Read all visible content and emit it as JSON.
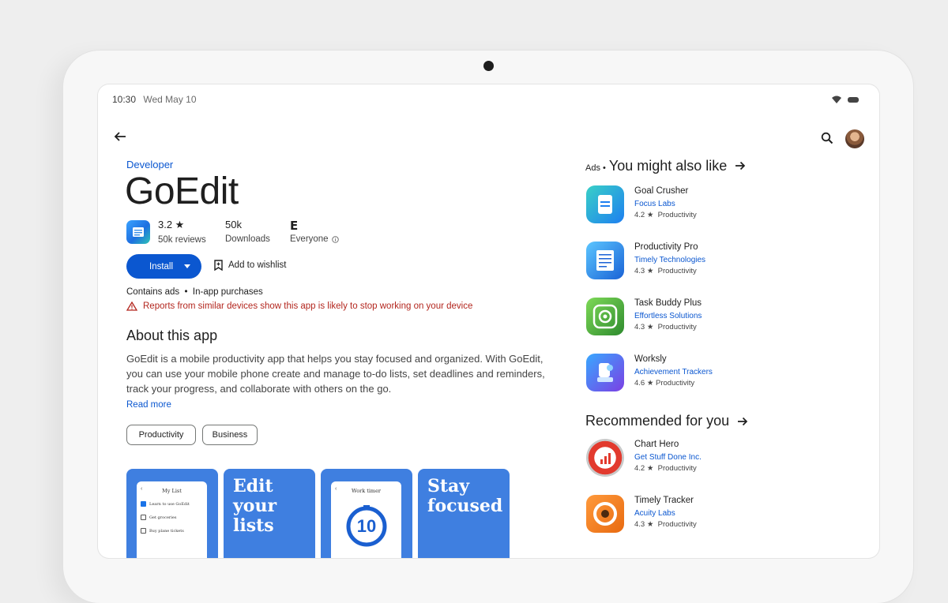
{
  "status": {
    "time": "10:30",
    "date": "Wed May 10"
  },
  "app": {
    "developer": "Developer",
    "title": "GoEdit",
    "rating": "3.2 ★",
    "reviews": "50k reviews",
    "downloads_value": "50k",
    "downloads_label": "Downloads",
    "content_rating_badge": "E",
    "content_rating_label": "Everyone",
    "install_label": "Install",
    "wishlist_label": "Add to wishlist",
    "meta": "Contains ads  •  In-app purchases",
    "warning": "Reports from similar devices show this app is likely to stop working on your device"
  },
  "about": {
    "title": "About this app",
    "text": "GoEdit is a mobile productivity app that helps you stay focused and organized. With GoEdit, you can use your mobile phone create and manage to-do lists, set deadlines and reminders, track your progress, and collaborate with others on the go.",
    "read_more": "Read more"
  },
  "chips": [
    "Productivity",
    "Business"
  ],
  "screenshots": {
    "shot1": {
      "list_title": "My List",
      "items": [
        "Learn to use GoEdit",
        "Get groceries",
        "Buy plane tickets"
      ]
    },
    "shot2_text": "Edit your lists",
    "shot3": {
      "title": "Work timer",
      "value": "10"
    },
    "shot4_text": "Stay focused"
  },
  "ads_section": {
    "ads_label": "Ads •",
    "title": "You might also like",
    "items": [
      {
        "name": "Goal Crusher",
        "developer": "Focus Labs",
        "meta": "4.2 ★  Productivity"
      },
      {
        "name": "Productivity Pro",
        "developer": "Timely Technologies",
        "meta": "4.3 ★  Productivity"
      },
      {
        "name": "Task Buddy Plus",
        "developer": "Effortless Solutions",
        "meta": "4.3 ★  Productivity"
      },
      {
        "name": "Worksly",
        "developer": "Achievement Trackers",
        "meta": "4.6 ★ Productivity"
      }
    ]
  },
  "recommended": {
    "title": "Recommended for you",
    "items": [
      {
        "name": "Chart Hero",
        "developer": "Get Stuff Done Inc.",
        "meta": "4.2 ★  Productivity"
      },
      {
        "name": "Timely Tracker",
        "developer": "Acuity Labs",
        "meta": "4.3 ★  Productivity"
      }
    ]
  },
  "icons": {
    "back": "back-arrow-icon",
    "search": "search-icon",
    "wifi": "wifi-icon",
    "battery": "battery-icon",
    "bookmark": "bookmark-add-icon",
    "warning": "warning-triangle-icon",
    "arrow": "arrow-right-icon"
  },
  "colors": {
    "accent": "#0b57d0",
    "warning": "#b3261e",
    "screenshot_bg": "#3f7fe0"
  }
}
